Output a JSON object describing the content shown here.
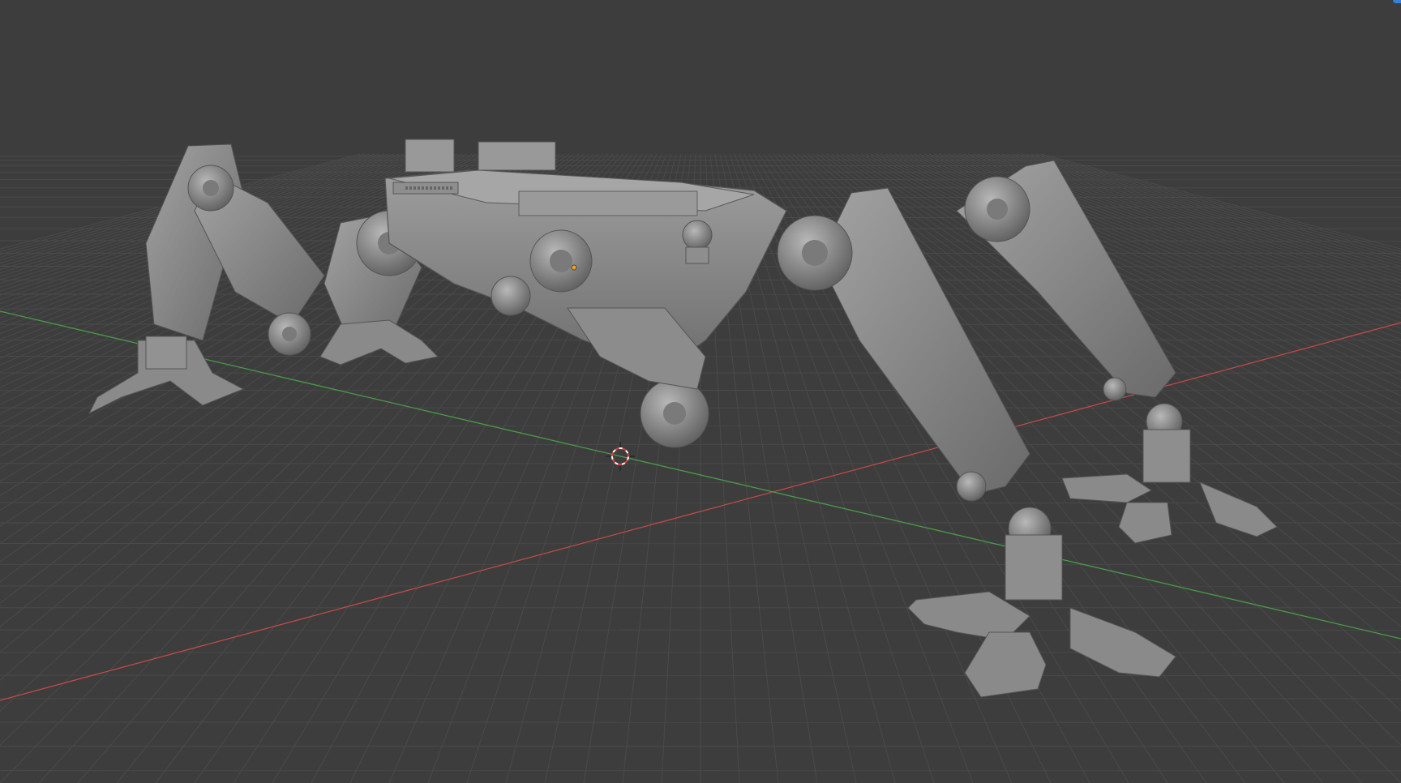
{
  "viewport": {
    "background": "#3d3d3d",
    "grid_color": "#4a4a4a",
    "x_axis_color": "#c44a4a",
    "y_axis_color": "#4a9a4a",
    "model_color": "#8a8a8a",
    "cursor_color": "#d64040",
    "corner_indicator_color": "#3c7fd6"
  },
  "scene": {
    "object_type": "mech-walker-model",
    "icons": [
      "3d-cursor-icon",
      "object-origin-icon"
    ]
  }
}
